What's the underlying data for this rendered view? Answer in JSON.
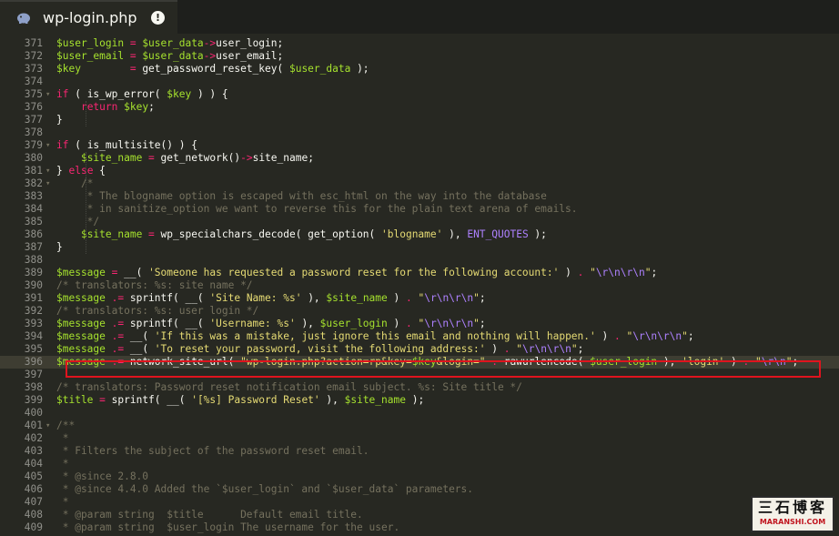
{
  "tab": {
    "title": "wp-login.php",
    "status_icon": "warning-icon",
    "status_glyph": "!"
  },
  "watermark": {
    "logo_cn": "三石博客",
    "logo_en": "MARANSHI.COM"
  },
  "lines": [
    {
      "n": "371",
      "fold": "",
      "segs": [
        [
          "v",
          "$user_login"
        ],
        [
          "k",
          " = "
        ],
        [
          "v",
          "$user_data"
        ],
        [
          "k",
          "->"
        ],
        [
          "t",
          "user_login;"
        ]
      ]
    },
    {
      "n": "372",
      "fold": "",
      "segs": [
        [
          "v",
          "$user_email"
        ],
        [
          "k",
          " = "
        ],
        [
          "v",
          "$user_data"
        ],
        [
          "k",
          "->"
        ],
        [
          "t",
          "user_email;"
        ]
      ]
    },
    {
      "n": "373",
      "fold": "",
      "segs": [
        [
          "v",
          "$key"
        ],
        [
          "k",
          "        = "
        ],
        [
          "t",
          "get_password_reset_key( "
        ],
        [
          "v",
          "$user_data"
        ],
        [
          "t",
          " );"
        ]
      ]
    },
    {
      "n": "374",
      "fold": "",
      "segs": []
    },
    {
      "n": "375",
      "fold": "▾",
      "segs": [
        [
          "k",
          "if"
        ],
        [
          "t",
          " ( is_wp_error( "
        ],
        [
          "v",
          "$key"
        ],
        [
          "t",
          " ) ) {"
        ]
      ]
    },
    {
      "n": "376",
      "fold": "",
      "segs": [
        [
          "t",
          "    "
        ],
        [
          "k",
          "return"
        ],
        [
          "t",
          " "
        ],
        [
          "v",
          "$key"
        ],
        [
          "t",
          ";"
        ]
      ]
    },
    {
      "n": "377",
      "fold": "",
      "segs": [
        [
          "t",
          "}"
        ]
      ]
    },
    {
      "n": "378",
      "fold": "",
      "segs": []
    },
    {
      "n": "379",
      "fold": "▾",
      "segs": [
        [
          "k",
          "if"
        ],
        [
          "t",
          " ( is_multisite() ) {"
        ]
      ]
    },
    {
      "n": "380",
      "fold": "",
      "segs": [
        [
          "t",
          "    "
        ],
        [
          "v",
          "$site_name"
        ],
        [
          "k",
          " = "
        ],
        [
          "t",
          "get_network()"
        ],
        [
          "k",
          "->"
        ],
        [
          "t",
          "site_name;"
        ]
      ]
    },
    {
      "n": "381",
      "fold": "▾",
      "segs": [
        [
          "t",
          "} "
        ],
        [
          "k",
          "else"
        ],
        [
          "t",
          " {"
        ]
      ]
    },
    {
      "n": "382",
      "fold": "▾",
      "segs": [
        [
          "c",
          "    /*"
        ]
      ]
    },
    {
      "n": "383",
      "fold": "",
      "segs": [
        [
          "c",
          "     * The blogname option is escaped with esc_html on the way into the database"
        ]
      ]
    },
    {
      "n": "384",
      "fold": "",
      "segs": [
        [
          "c",
          "     * in sanitize_option we want to reverse this for the plain text arena of emails."
        ]
      ]
    },
    {
      "n": "385",
      "fold": "",
      "segs": [
        [
          "c",
          "     */"
        ]
      ]
    },
    {
      "n": "386",
      "fold": "",
      "segs": [
        [
          "t",
          "    "
        ],
        [
          "v",
          "$site_name"
        ],
        [
          "k",
          " = "
        ],
        [
          "t",
          "wp_specialchars_decode( get_option( "
        ],
        [
          "s",
          "'blogname'"
        ],
        [
          "t",
          " ), "
        ],
        [
          "e",
          "ENT_QUOTES"
        ],
        [
          "t",
          " );"
        ]
      ]
    },
    {
      "n": "387",
      "fold": "",
      "segs": [
        [
          "t",
          "}"
        ]
      ]
    },
    {
      "n": "388",
      "fold": "",
      "segs": []
    },
    {
      "n": "389",
      "fold": "",
      "segs": [
        [
          "v",
          "$message"
        ],
        [
          "k",
          " = "
        ],
        [
          "t",
          "__( "
        ],
        [
          "s",
          "'Someone has requested a password reset for the following account:'"
        ],
        [
          "t",
          " ) "
        ],
        [
          "k",
          "."
        ],
        [
          "t",
          " "
        ],
        [
          "s",
          "\""
        ],
        [
          "e",
          "\\r\\n\\r\\n"
        ],
        [
          "s",
          "\""
        ],
        [
          "t",
          ";"
        ]
      ]
    },
    {
      "n": "390",
      "fold": "",
      "segs": [
        [
          "c",
          "/* translators: %s: site name */"
        ]
      ]
    },
    {
      "n": "391",
      "fold": "",
      "segs": [
        [
          "v",
          "$message"
        ],
        [
          "k",
          " .= "
        ],
        [
          "t",
          "sprintf( __( "
        ],
        [
          "s",
          "'Site Name: %s'"
        ],
        [
          "t",
          " ), "
        ],
        [
          "v",
          "$site_name"
        ],
        [
          "t",
          " ) "
        ],
        [
          "k",
          "."
        ],
        [
          "t",
          " "
        ],
        [
          "s",
          "\""
        ],
        [
          "e",
          "\\r\\n\\r\\n"
        ],
        [
          "s",
          "\""
        ],
        [
          "t",
          ";"
        ]
      ]
    },
    {
      "n": "392",
      "fold": "",
      "segs": [
        [
          "c",
          "/* translators: %s: user login */"
        ]
      ]
    },
    {
      "n": "393",
      "fold": "",
      "segs": [
        [
          "v",
          "$message"
        ],
        [
          "k",
          " .= "
        ],
        [
          "t",
          "sprintf( __( "
        ],
        [
          "s",
          "'Username: %s'"
        ],
        [
          "t",
          " ), "
        ],
        [
          "v",
          "$user_login"
        ],
        [
          "t",
          " ) "
        ],
        [
          "k",
          "."
        ],
        [
          "t",
          " "
        ],
        [
          "s",
          "\""
        ],
        [
          "e",
          "\\r\\n\\r\\n"
        ],
        [
          "s",
          "\""
        ],
        [
          "t",
          ";"
        ]
      ]
    },
    {
      "n": "394",
      "fold": "",
      "segs": [
        [
          "v",
          "$message"
        ],
        [
          "k",
          " .= "
        ],
        [
          "t",
          "__( "
        ],
        [
          "s",
          "'If this was a mistake, just ignore this email and nothing will happen.'"
        ],
        [
          "t",
          " ) "
        ],
        [
          "k",
          "."
        ],
        [
          "t",
          " "
        ],
        [
          "s",
          "\""
        ],
        [
          "e",
          "\\r\\n\\r\\n"
        ],
        [
          "s",
          "\""
        ],
        [
          "t",
          ";"
        ]
      ]
    },
    {
      "n": "395",
      "fold": "",
      "segs": [
        [
          "v",
          "$message"
        ],
        [
          "k",
          " .= "
        ],
        [
          "t",
          "__( "
        ],
        [
          "s",
          "'To reset your password, visit the following address:'"
        ],
        [
          "t",
          " ) "
        ],
        [
          "k",
          "."
        ],
        [
          "t",
          " "
        ],
        [
          "s",
          "\""
        ],
        [
          "e",
          "\\r\\n\\r\\n"
        ],
        [
          "s",
          "\""
        ],
        [
          "t",
          ";"
        ]
      ]
    },
    {
      "n": "396",
      "fold": "",
      "active": true,
      "segs": [
        [
          "v",
          "$message"
        ],
        [
          "k",
          " .= "
        ],
        [
          "t",
          "network_site_url( "
        ],
        [
          "s",
          "\"wp-login.php?action=rp&key="
        ],
        [
          "v",
          "$key"
        ],
        [
          "s",
          "&login=\""
        ],
        [
          "t",
          " "
        ],
        [
          "k",
          "."
        ],
        [
          "t",
          " rawurlencode( "
        ],
        [
          "v",
          "$user_login"
        ],
        [
          "t",
          " ), "
        ],
        [
          "s",
          "'login'"
        ],
        [
          "t",
          " ) "
        ],
        [
          "k",
          "."
        ],
        [
          "t",
          " "
        ],
        [
          "s",
          "\""
        ],
        [
          "e",
          "\\r\\n"
        ],
        [
          "s",
          "\""
        ],
        [
          "t",
          ";"
        ]
      ]
    },
    {
      "n": "397",
      "fold": "",
      "segs": []
    },
    {
      "n": "398",
      "fold": "",
      "segs": [
        [
          "c",
          "/* translators: Password reset notification email subject. %s: Site title */"
        ]
      ]
    },
    {
      "n": "399",
      "fold": "",
      "segs": [
        [
          "v",
          "$title"
        ],
        [
          "k",
          " = "
        ],
        [
          "t",
          "sprintf( __( "
        ],
        [
          "s",
          "'[%s] Password Reset'"
        ],
        [
          "t",
          " ), "
        ],
        [
          "v",
          "$site_name"
        ],
        [
          "t",
          " );"
        ]
      ]
    },
    {
      "n": "400",
      "fold": "",
      "segs": []
    },
    {
      "n": "401",
      "fold": "▾",
      "segs": [
        [
          "c",
          "/**"
        ]
      ]
    },
    {
      "n": "402",
      "fold": "",
      "segs": [
        [
          "c",
          " *"
        ]
      ]
    },
    {
      "n": "403",
      "fold": "",
      "segs": [
        [
          "c",
          " * Filters the subject of the password reset email."
        ]
      ]
    },
    {
      "n": "404",
      "fold": "",
      "segs": [
        [
          "c",
          " *"
        ]
      ]
    },
    {
      "n": "405",
      "fold": "",
      "segs": [
        [
          "c",
          " * @since 2.8.0"
        ]
      ]
    },
    {
      "n": "406",
      "fold": "",
      "segs": [
        [
          "c",
          " * @since 4.4.0 Added the `$user_login` and `$user_data` parameters."
        ]
      ]
    },
    {
      "n": "407",
      "fold": "",
      "segs": [
        [
          "c",
          " *"
        ]
      ]
    },
    {
      "n": "408",
      "fold": "",
      "segs": [
        [
          "c",
          " * @param string  $title      Default email title."
        ]
      ]
    },
    {
      "n": "409",
      "fold": "",
      "segs": [
        [
          "c",
          " * @param string  $user_login The username for the user."
        ]
      ]
    }
  ]
}
